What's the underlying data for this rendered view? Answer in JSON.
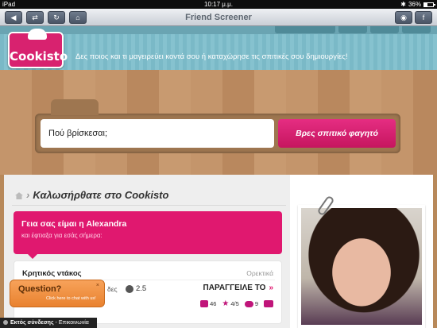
{
  "statusbar": {
    "device": "iPad",
    "time": "10:17 μ.μ.",
    "battery": "36%"
  },
  "toolbar": {
    "title": "Friend Screener",
    "buttons": [
      "back-icon",
      "forward-icon",
      "refresh-icon",
      "home-icon"
    ],
    "right_buttons": [
      "settings-icon",
      "facebook-icon"
    ]
  },
  "header": {
    "logo_text": "Cookisto",
    "tagline": "Δες ποιος και τι μαγειρεύει κοντά σου ή καταχώρησε τις σπιτικές σου δημιουργίες!"
  },
  "search": {
    "placeholder": "Πού βρίσκεσαι;",
    "button_label": "Βρες σπιτικό φαγητό"
  },
  "main": {
    "breadcrumb": "Καλωσήρθατε στο Cookisto",
    "greeting_title": "Γεια σας είμαι η Alexandra",
    "greeting_sub": "και έφτιαξα για εσάς σήμερα:",
    "dish": {
      "name": "Κρητικός ντάκος",
      "category": "Ορεκτικά",
      "days_fragment": "δες",
      "price": "2.5",
      "order_label": "ΠΑΡΑΓΓΕΙΛΕ ΤΟ",
      "order_arrow": "»",
      "stats": {
        "people": "46",
        "rating": "4/5",
        "comments": "9"
      }
    }
  },
  "chat": {
    "title": "Question?",
    "subtitle": "Click here to chat with us!",
    "close": "×",
    "status_bold": "Εκτός σύνδεσης",
    "status_rest": " - Επικοινωνία"
  },
  "colors": {
    "brand_pink": "#e0186f",
    "header_blue": "#7ab9c7",
    "chat_orange": "#f0913f"
  }
}
